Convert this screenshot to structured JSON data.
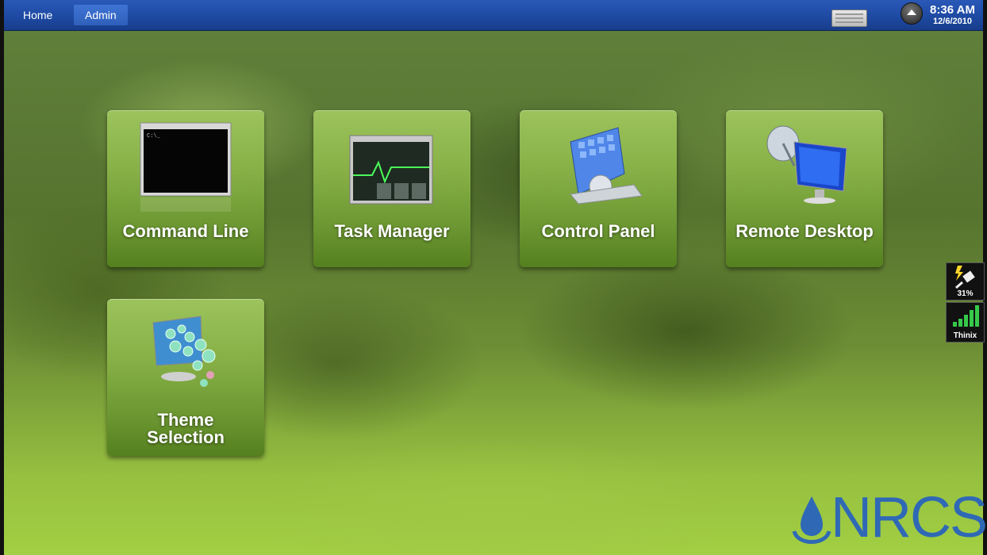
{
  "topbar": {
    "tabs": [
      {
        "label": "Home"
      },
      {
        "label": "Admin"
      }
    ],
    "clock": {
      "time": "8:36 AM",
      "date": "12/6/2010"
    }
  },
  "tiles": [
    {
      "label": "Command Line",
      "icon": "command-line-icon"
    },
    {
      "label": "Task Manager",
      "icon": "task-manager-icon"
    },
    {
      "label": "Control Panel",
      "icon": "control-panel-icon"
    },
    {
      "label": "Remote Desktop",
      "icon": "remote-desktop-icon"
    },
    {
      "label_line1": "Theme",
      "label_line2": "Selection",
      "icon": "theme-selection-icon"
    }
  ],
  "status": {
    "battery_percent": "31%",
    "network_name": "Thinix"
  },
  "logo": {
    "text": "NRCS"
  },
  "colors": {
    "accent": "#1e4aa3",
    "tile": "#86b046",
    "logo": "#2f69b5"
  }
}
